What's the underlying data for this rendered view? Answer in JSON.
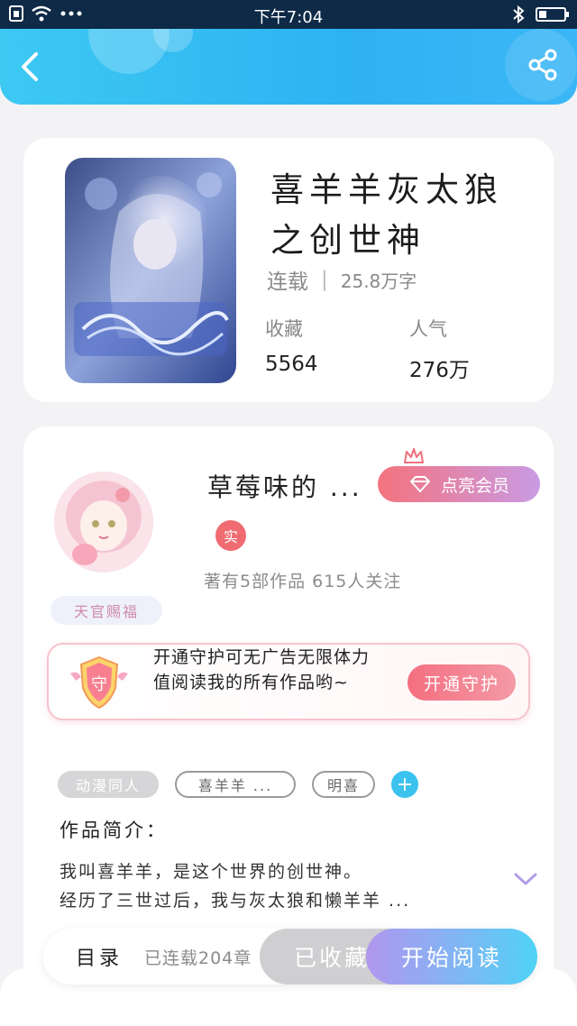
{
  "status_bar": {
    "time": "下午7:04",
    "battery_level": 0.3
  },
  "book": {
    "title": "喜羊羊灰太狼之创世神",
    "status": "连载",
    "word_count": "25.8万字",
    "favorites_label": "收藏",
    "favorites_value": "5564",
    "popularity_label": "人气",
    "popularity_value": "276万"
  },
  "author": {
    "name": "草莓味的 ...",
    "vip_label": "点亮会员",
    "real_badge": "实",
    "stats": "著有5部作品 615人关注",
    "honor_tag": "天官赐福"
  },
  "guard": {
    "icon_char": "守",
    "text": "开通守护可无广告无限体力值阅读我的所有作品哟~",
    "button_label": "开通守护"
  },
  "tags": [
    {
      "label": "动漫同人"
    },
    {
      "label": "喜羊羊 ..."
    },
    {
      "label": "明喜"
    }
  ],
  "tag_add_label": "+",
  "intro": {
    "title": "作品简介：",
    "line1": "我叫喜羊羊，是这个世界的创世神。",
    "line2": "经历了三世过后，我与灰太狼和懒羊羊 ..."
  },
  "bottom_bar": {
    "catalog_label": "目录",
    "catalog_count": "已连载204章",
    "favorite_label": "已收藏",
    "read_label": "开始阅读"
  },
  "colors": {
    "header": "#2fb2f2",
    "vip_gradient_start": "#f4737e",
    "vip_gradient_end": "#c99be4",
    "read_gradient_end": "#4fd2f6"
  },
  "icons": [
    "back-arrow-icon",
    "share-icon",
    "crown-icon",
    "diamond-icon",
    "shield-icon",
    "expand-chevron-icon"
  ]
}
